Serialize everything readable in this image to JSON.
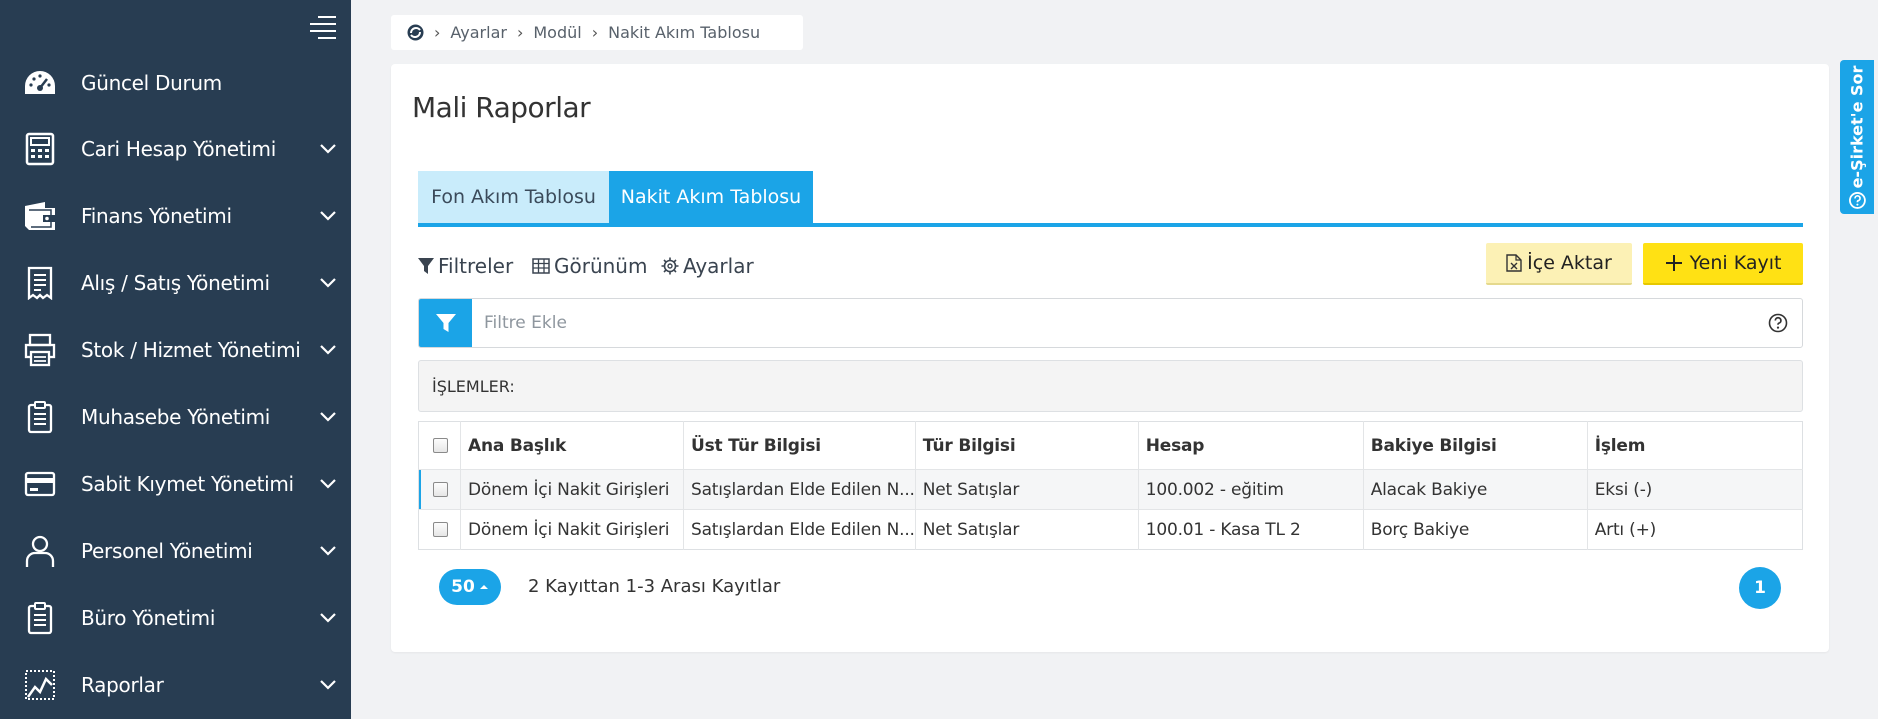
{
  "sidebar": {
    "items": [
      {
        "label": "Güncel Durum",
        "icon": "dashboard-icon",
        "expandable": false
      },
      {
        "label": "Cari Hesap Yönetimi",
        "icon": "calculator-icon",
        "expandable": true
      },
      {
        "label": "Finans Yönetimi",
        "icon": "wallet-icon",
        "expandable": true
      },
      {
        "label": "Alış / Satış Yönetimi",
        "icon": "receipt-icon",
        "expandable": true
      },
      {
        "label": "Stok / Hizmet Yönetimi",
        "icon": "printer-icon",
        "expandable": true
      },
      {
        "label": "Muhasebe Yönetimi",
        "icon": "clipboard-icon",
        "expandable": true
      },
      {
        "label": "Sabit Kıymet Yönetimi",
        "icon": "credit-card-icon",
        "expandable": true
      },
      {
        "label": "Personel Yönetimi",
        "icon": "person-icon",
        "expandable": true
      },
      {
        "label": "Büro Yönetimi",
        "icon": "clipboard-icon",
        "expandable": true
      },
      {
        "label": "Raporlar",
        "icon": "chart-icon",
        "expandable": true
      }
    ]
  },
  "breadcrumb": {
    "items": [
      "Ayarlar",
      "Modül",
      "Nakit Akım Tablosu"
    ]
  },
  "page": {
    "title": "Mali Raporlar"
  },
  "tabs": [
    {
      "label": "Fon Akım Tablosu",
      "active": false
    },
    {
      "label": "Nakit Akım Tablosu",
      "active": true
    }
  ],
  "toolbar": {
    "filters": "Filtreler",
    "view": "Görünüm",
    "settings": "Ayarlar",
    "import": "İçe Aktar",
    "new_record": "Yeni Kayıt"
  },
  "filter": {
    "placeholder": "Filtre Ekle"
  },
  "operations": {
    "label": "İŞLEMLER:"
  },
  "table": {
    "columns": [
      "Ana Başlık",
      "Üst Tür Bilgisi",
      "Tür Bilgisi",
      "Hesap",
      "Bakiye Bilgisi",
      "İşlem"
    ],
    "rows": [
      [
        "Dönem İçi Nakit Girişleri",
        "Satışlardan Elde Edilen N...",
        "Net Satışlar",
        "100.002 - eğitim",
        "Alacak Bakiye",
        "Eksi (-)"
      ],
      [
        "Dönem İçi Nakit Girişleri",
        "Satışlardan Elde Edilen N...",
        "Net Satışlar",
        "100.01 - Kasa TL 2",
        "Borç Bakiye",
        "Artı (+)"
      ]
    ]
  },
  "pagination": {
    "page_size": "50",
    "info": "2 Kayıttan 1-3 Arası Kayıtlar",
    "current_page": "1"
  },
  "side_tab": {
    "label": "e-Şirket'e Sor"
  },
  "colors": {
    "sidebar_bg": "#283d52",
    "accent": "#1ba4e7",
    "primary_button": "#ffe114",
    "secondary_button": "#fcf1b5"
  }
}
